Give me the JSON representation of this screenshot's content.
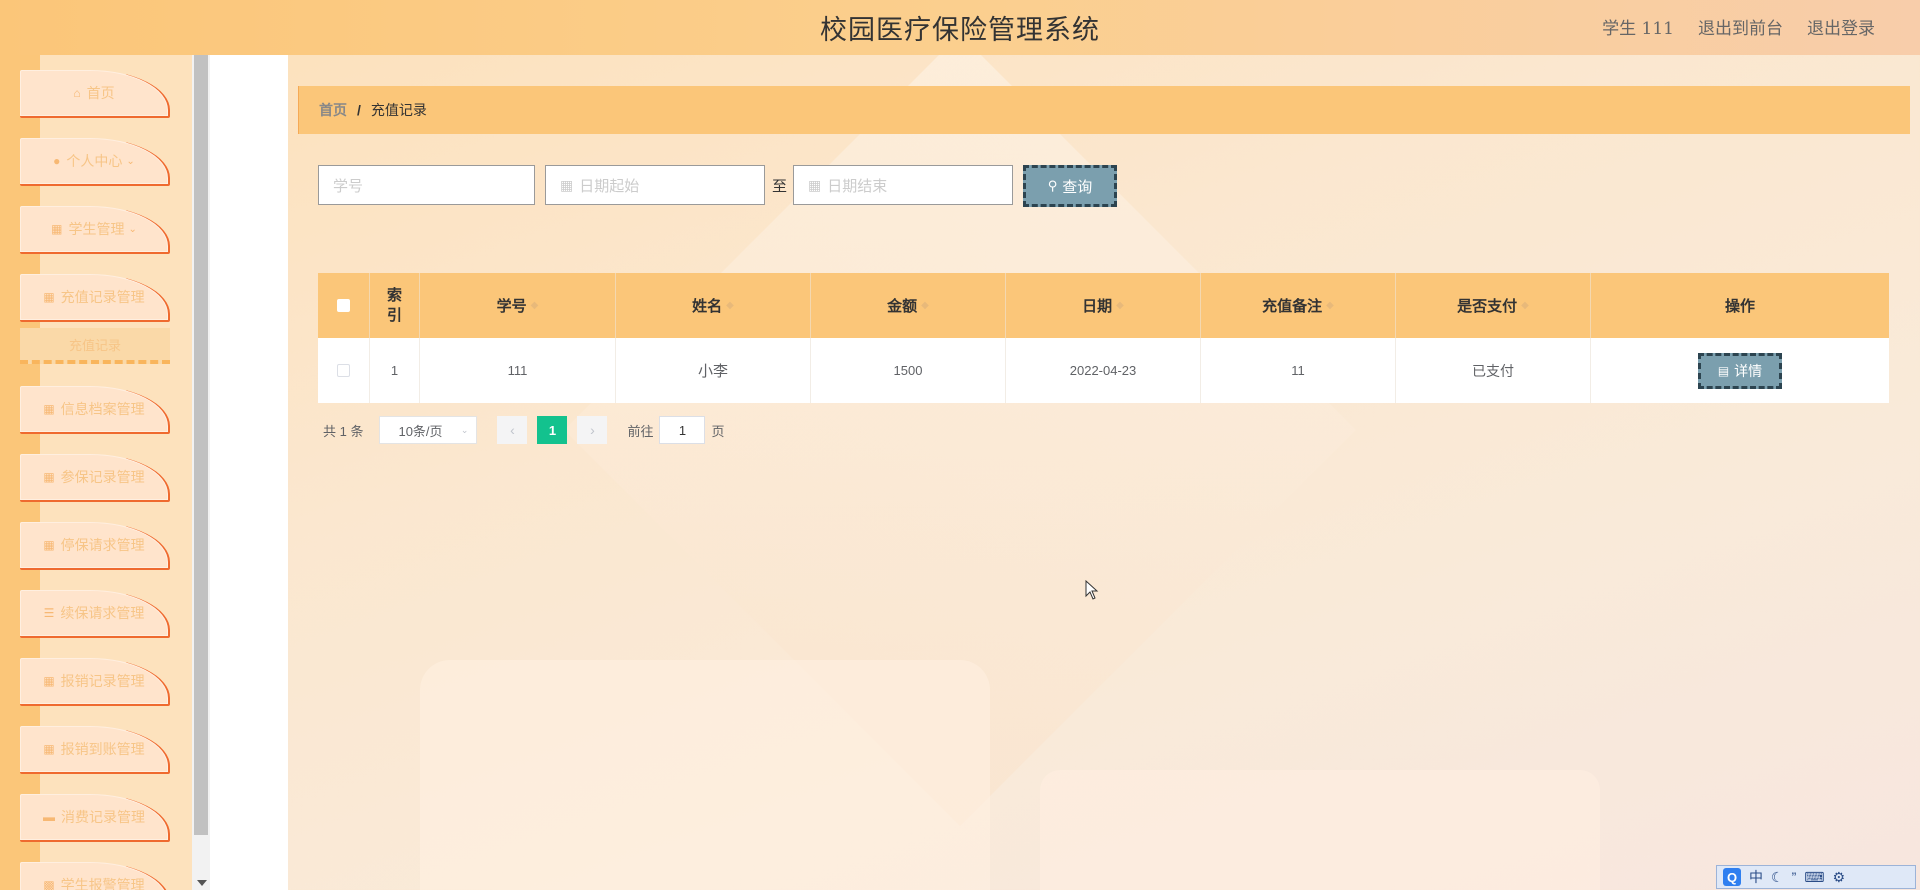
{
  "header": {
    "title": "校园医疗保险管理系统",
    "user": "学生 111",
    "to_front": "退出到前台",
    "logout": "退出登录"
  },
  "sidebar": {
    "items": [
      {
        "label": "首页",
        "icon": "home-icon"
      },
      {
        "label": "个人中心",
        "icon": "user-icon"
      },
      {
        "label": "学生管理",
        "icon": "grid-icon"
      },
      {
        "label": "充值记录管理",
        "icon": "grid-icon"
      },
      {
        "label": "信息档案管理",
        "icon": "grid-icon"
      },
      {
        "label": "参保记录管理",
        "icon": "grid-icon"
      },
      {
        "label": "停保请求管理",
        "icon": "grid-icon"
      },
      {
        "label": "续保请求管理",
        "icon": "list-icon"
      },
      {
        "label": "报销记录管理",
        "icon": "grid-icon"
      },
      {
        "label": "报销到账管理",
        "icon": "table-icon"
      },
      {
        "label": "消费记录管理",
        "icon": "card-icon"
      },
      {
        "label": "学生报警管理",
        "icon": "doc-icon"
      }
    ],
    "submenu": "充值记录"
  },
  "breadcrumb": {
    "home": "首页",
    "separator": "/",
    "current": "充值记录"
  },
  "search": {
    "student_no_placeholder": "学号",
    "date_start_placeholder": "日期起始",
    "to_label": "至",
    "date_end_placeholder": "日期结束",
    "button": "查询"
  },
  "table": {
    "headers": {
      "index": "索引",
      "student_no": "学号",
      "name": "姓名",
      "amount": "金额",
      "date": "日期",
      "remark": "充值备注",
      "paid": "是否支付",
      "action": "操作"
    },
    "rows": [
      {
        "index": "1",
        "student_no": "111",
        "name": "小李",
        "amount": "1500",
        "date": "2022-04-23",
        "remark": "11",
        "paid": "已支付",
        "action": "详情"
      }
    ]
  },
  "pagination": {
    "total": "共 1 条",
    "page_size": "10条/页",
    "current_page": "1",
    "goto_prefix": "前往",
    "goto_value": "1",
    "goto_suffix": "页"
  },
  "ime": {
    "label": "中"
  },
  "colors": {
    "accent": "#fbc679",
    "menu_border": "#ef6a2f",
    "button_bg": "#7b9fae",
    "active_page": "#13c28e"
  }
}
